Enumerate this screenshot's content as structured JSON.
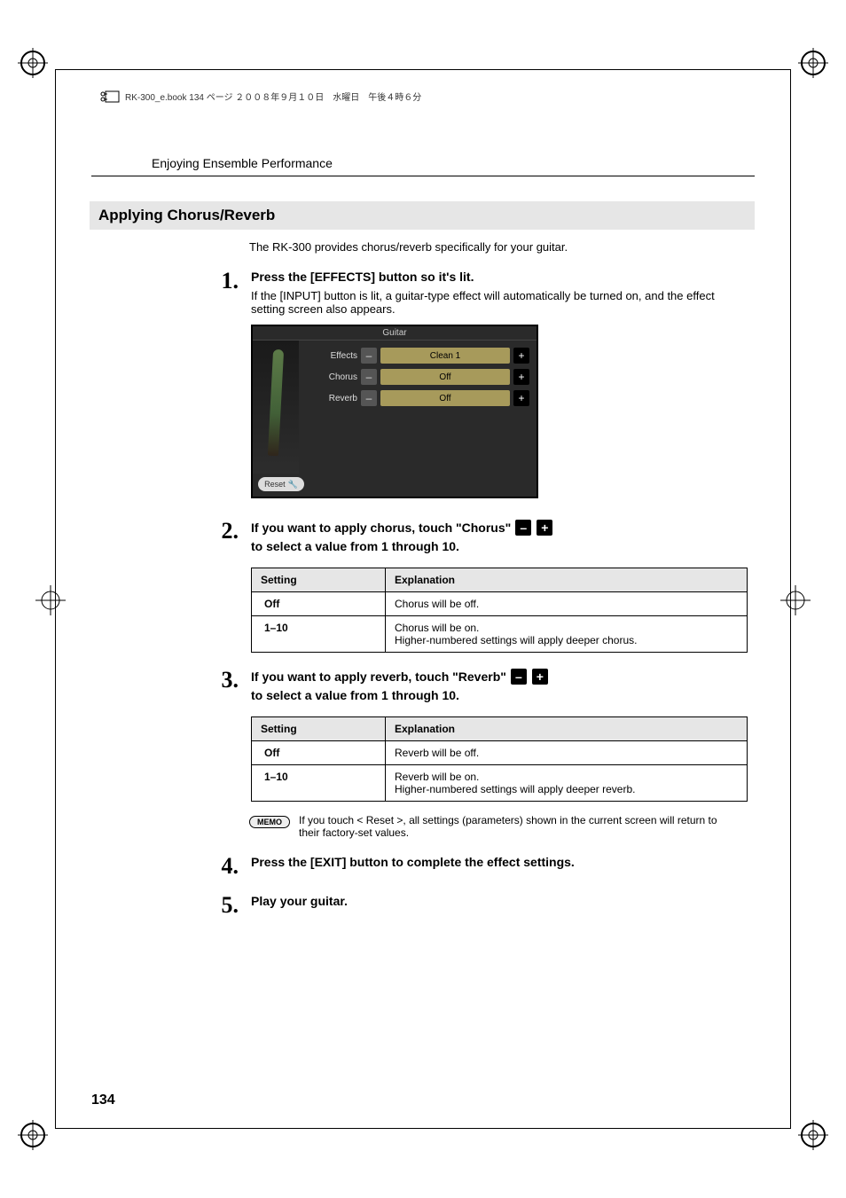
{
  "top_header": "RK-300_e.book  134 ページ  ２００８年９月１０日　水曜日　午後４時６分",
  "running_header": "Enjoying Ensemble Performance",
  "section_title": "Applying Chorus/Reverb",
  "intro": "The RK-300 provides chorus/reverb specifically for your guitar.",
  "steps": {
    "s1": {
      "num": "1.",
      "heading": "Press the [EFFECTS] button so it's lit.",
      "body": "If the [INPUT] button is lit, a guitar-type effect will automatically be turned on, and the effect setting screen also appears."
    },
    "s2": {
      "num": "2.",
      "heading_pre": "If you want to apply chorus, touch \"Chorus\" ",
      "heading_post": " to select a value from 1 through 10."
    },
    "s3": {
      "num": "3.",
      "heading_pre": "If you want to apply reverb, touch \"Reverb\" ",
      "heading_post": " to select a value from 1 through 10."
    },
    "s4": {
      "num": "4.",
      "heading": "Press the [EXIT] button to complete the effect settings."
    },
    "s5": {
      "num": "5.",
      "heading": "Play your guitar."
    }
  },
  "gscreen": {
    "title": "Guitar",
    "rows": {
      "effects": {
        "label": "Effects",
        "value": "Clean 1"
      },
      "chorus": {
        "label": "Chorus",
        "value": "Off"
      },
      "reverb": {
        "label": "Reverb",
        "value": "Off"
      }
    },
    "reset": "Reset"
  },
  "table_chorus": {
    "head_setting": "Setting",
    "head_expl": "Explanation",
    "rows": [
      {
        "setting": "Off",
        "expl": "Chorus will be off."
      },
      {
        "setting": "1–10",
        "expl": "Chorus will be on.\nHigher-numbered settings will apply deeper chorus."
      }
    ]
  },
  "table_reverb": {
    "head_setting": "Setting",
    "head_expl": "Explanation",
    "rows": [
      {
        "setting": "Off",
        "expl": "Reverb will be off."
      },
      {
        "setting": "1–10",
        "expl": "Reverb will be on.\nHigher-numbered settings will apply deeper reverb."
      }
    ]
  },
  "memo": {
    "label": "MEMO",
    "text": "If you touch < Reset >, all settings (parameters) shown in the current screen will return to their factory-set values."
  },
  "page_number": "134",
  "glyphs": {
    "minus": "–",
    "plus": "+",
    "wrench": "🔧"
  }
}
